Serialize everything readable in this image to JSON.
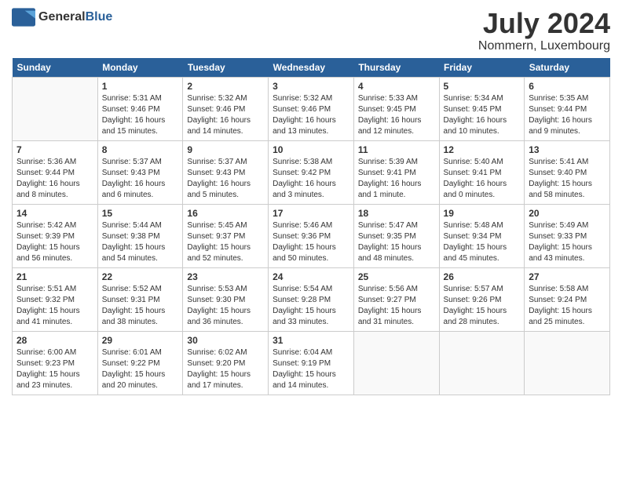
{
  "header": {
    "logo_general": "General",
    "logo_blue": "Blue",
    "month_year": "July 2024",
    "location": "Nommern, Luxembourg"
  },
  "weekdays": [
    "Sunday",
    "Monday",
    "Tuesday",
    "Wednesday",
    "Thursday",
    "Friday",
    "Saturday"
  ],
  "weeks": [
    [
      {
        "day": "",
        "sunrise": "",
        "sunset": "",
        "daylight": ""
      },
      {
        "day": "1",
        "sunrise": "Sunrise: 5:31 AM",
        "sunset": "Sunset: 9:46 PM",
        "daylight": "Daylight: 16 hours and 15 minutes."
      },
      {
        "day": "2",
        "sunrise": "Sunrise: 5:32 AM",
        "sunset": "Sunset: 9:46 PM",
        "daylight": "Daylight: 16 hours and 14 minutes."
      },
      {
        "day": "3",
        "sunrise": "Sunrise: 5:32 AM",
        "sunset": "Sunset: 9:46 PM",
        "daylight": "Daylight: 16 hours and 13 minutes."
      },
      {
        "day": "4",
        "sunrise": "Sunrise: 5:33 AM",
        "sunset": "Sunset: 9:45 PM",
        "daylight": "Daylight: 16 hours and 12 minutes."
      },
      {
        "day": "5",
        "sunrise": "Sunrise: 5:34 AM",
        "sunset": "Sunset: 9:45 PM",
        "daylight": "Daylight: 16 hours and 10 minutes."
      },
      {
        "day": "6",
        "sunrise": "Sunrise: 5:35 AM",
        "sunset": "Sunset: 9:44 PM",
        "daylight": "Daylight: 16 hours and 9 minutes."
      }
    ],
    [
      {
        "day": "7",
        "sunrise": "Sunrise: 5:36 AM",
        "sunset": "Sunset: 9:44 PM",
        "daylight": "Daylight: 16 hours and 8 minutes."
      },
      {
        "day": "8",
        "sunrise": "Sunrise: 5:37 AM",
        "sunset": "Sunset: 9:43 PM",
        "daylight": "Daylight: 16 hours and 6 minutes."
      },
      {
        "day": "9",
        "sunrise": "Sunrise: 5:37 AM",
        "sunset": "Sunset: 9:43 PM",
        "daylight": "Daylight: 16 hours and 5 minutes."
      },
      {
        "day": "10",
        "sunrise": "Sunrise: 5:38 AM",
        "sunset": "Sunset: 9:42 PM",
        "daylight": "Daylight: 16 hours and 3 minutes."
      },
      {
        "day": "11",
        "sunrise": "Sunrise: 5:39 AM",
        "sunset": "Sunset: 9:41 PM",
        "daylight": "Daylight: 16 hours and 1 minute."
      },
      {
        "day": "12",
        "sunrise": "Sunrise: 5:40 AM",
        "sunset": "Sunset: 9:41 PM",
        "daylight": "Daylight: 16 hours and 0 minutes."
      },
      {
        "day": "13",
        "sunrise": "Sunrise: 5:41 AM",
        "sunset": "Sunset: 9:40 PM",
        "daylight": "Daylight: 15 hours and 58 minutes."
      }
    ],
    [
      {
        "day": "14",
        "sunrise": "Sunrise: 5:42 AM",
        "sunset": "Sunset: 9:39 PM",
        "daylight": "Daylight: 15 hours and 56 minutes."
      },
      {
        "day": "15",
        "sunrise": "Sunrise: 5:44 AM",
        "sunset": "Sunset: 9:38 PM",
        "daylight": "Daylight: 15 hours and 54 minutes."
      },
      {
        "day": "16",
        "sunrise": "Sunrise: 5:45 AM",
        "sunset": "Sunset: 9:37 PM",
        "daylight": "Daylight: 15 hours and 52 minutes."
      },
      {
        "day": "17",
        "sunrise": "Sunrise: 5:46 AM",
        "sunset": "Sunset: 9:36 PM",
        "daylight": "Daylight: 15 hours and 50 minutes."
      },
      {
        "day": "18",
        "sunrise": "Sunrise: 5:47 AM",
        "sunset": "Sunset: 9:35 PM",
        "daylight": "Daylight: 15 hours and 48 minutes."
      },
      {
        "day": "19",
        "sunrise": "Sunrise: 5:48 AM",
        "sunset": "Sunset: 9:34 PM",
        "daylight": "Daylight: 15 hours and 45 minutes."
      },
      {
        "day": "20",
        "sunrise": "Sunrise: 5:49 AM",
        "sunset": "Sunset: 9:33 PM",
        "daylight": "Daylight: 15 hours and 43 minutes."
      }
    ],
    [
      {
        "day": "21",
        "sunrise": "Sunrise: 5:51 AM",
        "sunset": "Sunset: 9:32 PM",
        "daylight": "Daylight: 15 hours and 41 minutes."
      },
      {
        "day": "22",
        "sunrise": "Sunrise: 5:52 AM",
        "sunset": "Sunset: 9:31 PM",
        "daylight": "Daylight: 15 hours and 38 minutes."
      },
      {
        "day": "23",
        "sunrise": "Sunrise: 5:53 AM",
        "sunset": "Sunset: 9:30 PM",
        "daylight": "Daylight: 15 hours and 36 minutes."
      },
      {
        "day": "24",
        "sunrise": "Sunrise: 5:54 AM",
        "sunset": "Sunset: 9:28 PM",
        "daylight": "Daylight: 15 hours and 33 minutes."
      },
      {
        "day": "25",
        "sunrise": "Sunrise: 5:56 AM",
        "sunset": "Sunset: 9:27 PM",
        "daylight": "Daylight: 15 hours and 31 minutes."
      },
      {
        "day": "26",
        "sunrise": "Sunrise: 5:57 AM",
        "sunset": "Sunset: 9:26 PM",
        "daylight": "Daylight: 15 hours and 28 minutes."
      },
      {
        "day": "27",
        "sunrise": "Sunrise: 5:58 AM",
        "sunset": "Sunset: 9:24 PM",
        "daylight": "Daylight: 15 hours and 25 minutes."
      }
    ],
    [
      {
        "day": "28",
        "sunrise": "Sunrise: 6:00 AM",
        "sunset": "Sunset: 9:23 PM",
        "daylight": "Daylight: 15 hours and 23 minutes."
      },
      {
        "day": "29",
        "sunrise": "Sunrise: 6:01 AM",
        "sunset": "Sunset: 9:22 PM",
        "daylight": "Daylight: 15 hours and 20 minutes."
      },
      {
        "day": "30",
        "sunrise": "Sunrise: 6:02 AM",
        "sunset": "Sunset: 9:20 PM",
        "daylight": "Daylight: 15 hours and 17 minutes."
      },
      {
        "day": "31",
        "sunrise": "Sunrise: 6:04 AM",
        "sunset": "Sunset: 9:19 PM",
        "daylight": "Daylight: 15 hours and 14 minutes."
      },
      {
        "day": "",
        "sunrise": "",
        "sunset": "",
        "daylight": ""
      },
      {
        "day": "",
        "sunrise": "",
        "sunset": "",
        "daylight": ""
      },
      {
        "day": "",
        "sunrise": "",
        "sunset": "",
        "daylight": ""
      }
    ]
  ]
}
